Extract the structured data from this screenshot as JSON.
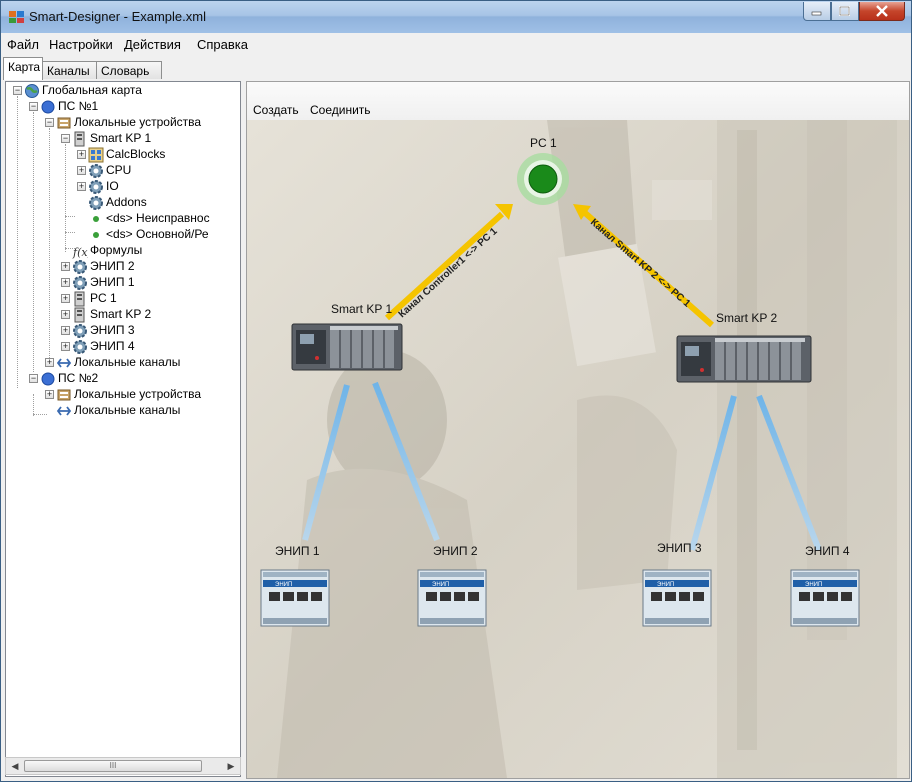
{
  "window": {
    "title": "Smart-Designer - Example.xml"
  },
  "menu": [
    "Файл",
    "Настройки",
    "Действия",
    "Справка"
  ],
  "tabs": [
    "Карта",
    "Каналы",
    "Словарь"
  ],
  "tree": {
    "root": "Глобальная карта",
    "ps1": "ПС №1",
    "local_devices_1": "Локальные устройства",
    "smart_kp1": "Smart KP 1",
    "calcblocks": "CalcBlocks",
    "cpu": "CPU",
    "io": "IO",
    "addons": "Addons",
    "ds_fault": "<ds> Неисправнос",
    "ds_main": "<ds> Основной/Ре",
    "formulas": "Формулы",
    "enip2": "ЭНИП 2",
    "enip1": "ЭНИП 1",
    "pc1": "PC 1",
    "smart_kp2": "Smart KP 2",
    "enip3": "ЭНИП 3",
    "enip4": "ЭНИП 4",
    "local_channels_1": "Локальные каналы",
    "ps2": "ПС №2",
    "local_devices_2": "Локальные устройства",
    "local_channels_2": "Локальные каналы"
  },
  "scrollbar": {
    "thumb_glyph": "III"
  },
  "toolbar": {
    "create": "Создать",
    "connect": "Соединить"
  },
  "map": {
    "pc1": "PC 1",
    "kp1": "Smart KP 1",
    "kp2": "Smart KP 2",
    "enip1": "ЭНИП 1",
    "enip2": "ЭНИП 2",
    "enip3": "ЭНИП 3",
    "enip4": "ЭНИП 4",
    "channel1": "Канал Controller1 <-> PC 1",
    "channel2": "Канал Smart KP 2 <-> PC 1",
    "enip_device_text": "ЭНИП"
  },
  "colors": {
    "accent_link": "#f5c400",
    "device_link": "#7fb8e0",
    "pc_green": "#1a8a1a",
    "background": "#d9d4c8"
  }
}
